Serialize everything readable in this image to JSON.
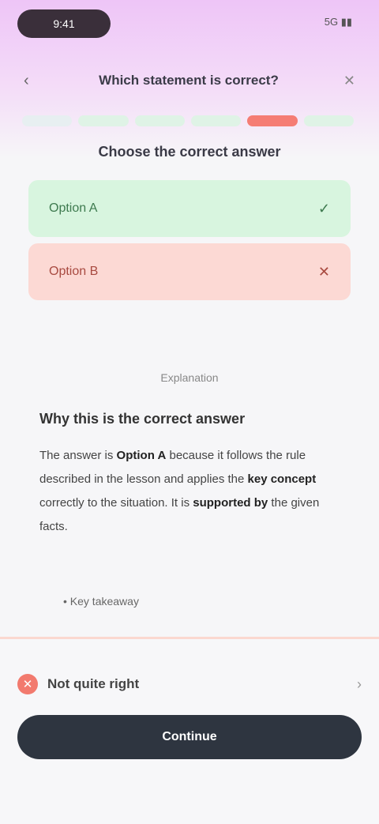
{
  "status_bar": {
    "left_label": "9:41",
    "right_label": "5G ▮▮"
  },
  "nav": {
    "title": "Which statement is correct?",
    "right_icon": "close-icon"
  },
  "progress": {
    "segments": [
      "#e7eff1",
      "#dff3e6",
      "#dff3e6",
      "#dff3e6",
      "#f57d74",
      "#dff3e6"
    ]
  },
  "question": "Choose the correct answer",
  "options": {
    "correct": {
      "label": "Option A",
      "icon": "check-icon"
    },
    "wrong": {
      "label": "Option B",
      "icon": "x-icon"
    }
  },
  "explanation": {
    "heading": "Explanation",
    "title": "Why this is the correct answer",
    "body_1": "The answer is ",
    "body_bold_1": "Option A",
    "body_2": " because it follows the rule described in the lesson and applies the ",
    "body_bold_2": "key concept",
    "body_3": " correctly to the situation. It is ",
    "body_bold_3": "supported by",
    "body_4": " the given facts.",
    "list_item": "Key takeaway"
  },
  "footer": {
    "feedback_label": "Not quite right",
    "continue_label": "Continue"
  }
}
